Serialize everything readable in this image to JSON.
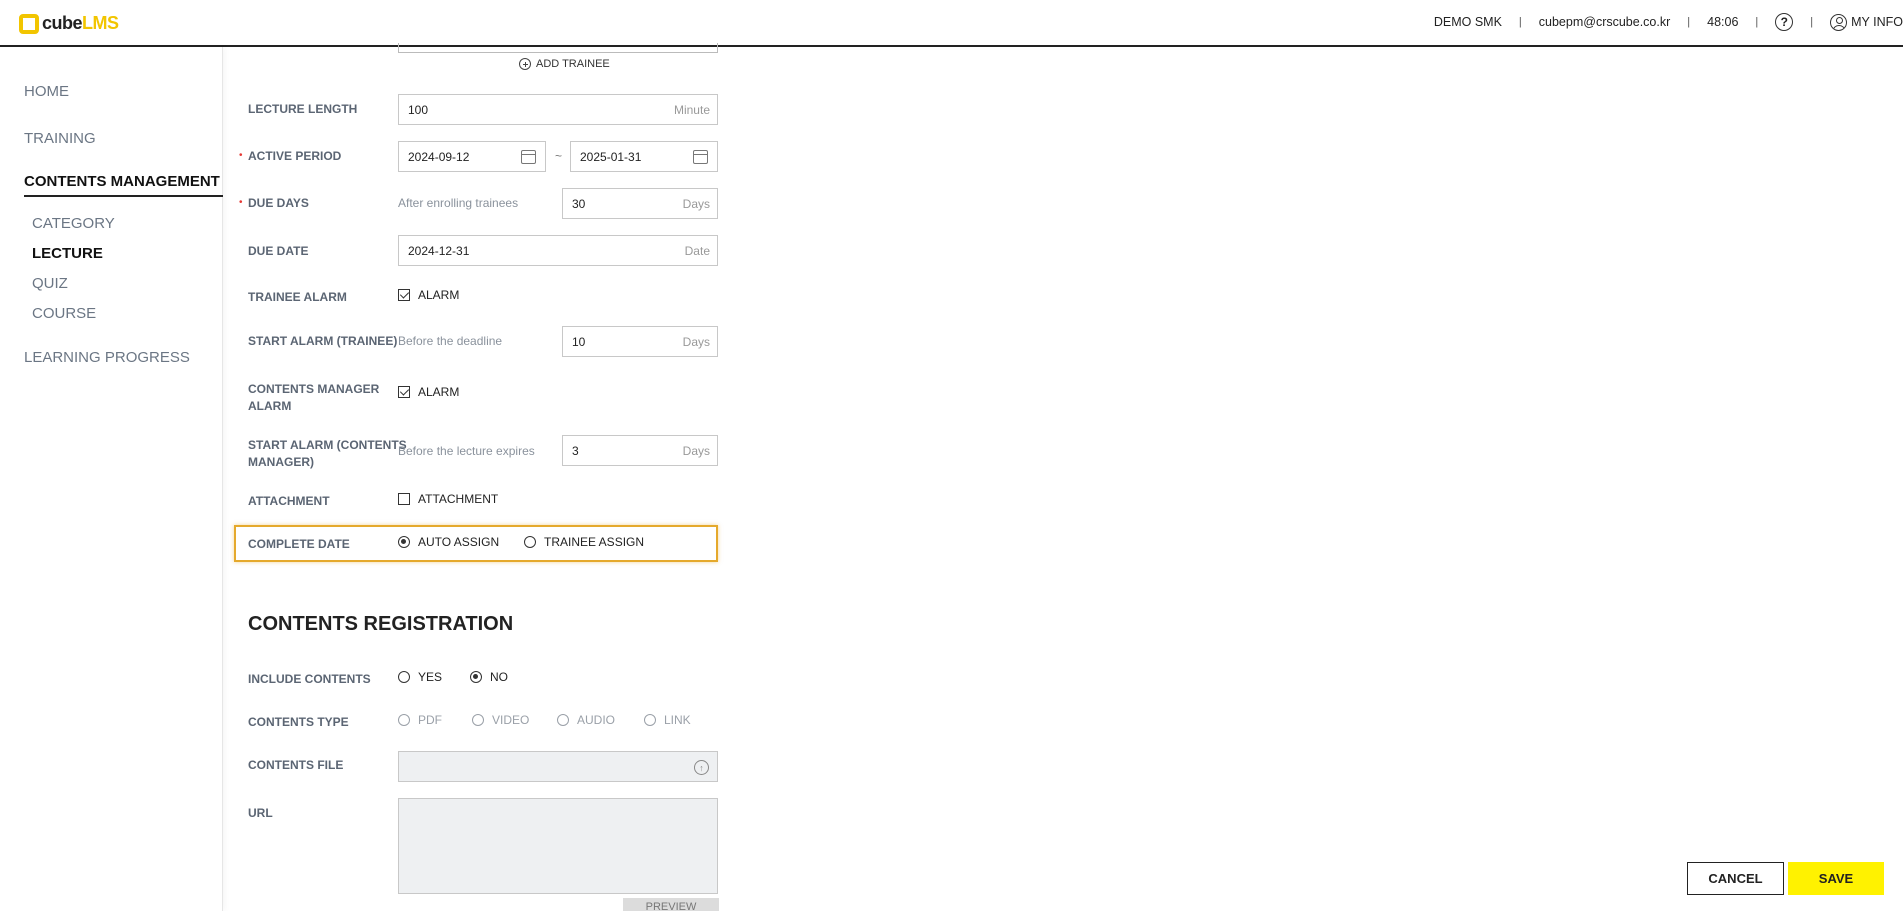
{
  "header": {
    "logo_cube": "cube",
    "logo_lms": "LMS",
    "user_name": "DEMO SMK",
    "email": "cubepm@crscube.co.kr",
    "timer": "48:06",
    "help_icon": "help-circle-icon",
    "my_info": "MY INFO",
    "separator": "|"
  },
  "sidebar": {
    "home": "HOME",
    "training": "TRAINING",
    "contents_management": "CONTENTS MANAGEMENT",
    "sub": {
      "category": "CATEGORY",
      "lecture": "LECTURE",
      "quiz": "QUIZ",
      "course": "COURSE"
    },
    "learning_progress": "LEARNING PROGRESS"
  },
  "form": {
    "add_trainee": "ADD TRAINEE",
    "lecture_length": {
      "label": "LECTURE LENGTH",
      "value": "100",
      "unit": "Minute"
    },
    "active_period": {
      "label": "ACTIVE PERIOD",
      "start": "2024-09-12",
      "end": "2025-01-31",
      "tilde": "~"
    },
    "due_days": {
      "label": "DUE DAYS",
      "hint": "After enrolling trainees",
      "value": "30",
      "unit": "Days"
    },
    "due_date": {
      "label": "DUE DATE",
      "value": "2024-12-31",
      "unit": "Date"
    },
    "trainee_alarm": {
      "label": "TRAINEE ALARM",
      "option": "ALARM",
      "checked": true
    },
    "start_alarm_trainee": {
      "label": "START ALARM (TRAINEE)",
      "hint": "Before the deadline",
      "value": "10",
      "unit": "Days"
    },
    "contents_manager_alarm": {
      "label_line1": "CONTENTS MANAGER",
      "label_line2": "ALARM",
      "option": "ALARM",
      "checked": true
    },
    "start_alarm_manager": {
      "label_line1": "START ALARM (CONTENTS",
      "label_line2": "MANAGER)",
      "hint": "Before the lecture expires",
      "value": "3",
      "unit": "Days"
    },
    "attachment": {
      "label": "ATTACHMENT",
      "option": "ATTACHMENT",
      "checked": false
    },
    "complete_date": {
      "label": "COMPLETE DATE",
      "options": [
        "AUTO ASSIGN",
        "TRAINEE ASSIGN"
      ],
      "selected": "AUTO ASSIGN"
    },
    "required_mark": "•"
  },
  "contents_registration": {
    "title": "CONTENTS REGISTRATION",
    "include_contents": {
      "label": "INCLUDE CONTENTS",
      "options": [
        "YES",
        "NO"
      ],
      "selected": "NO"
    },
    "contents_type": {
      "label": "CONTENTS TYPE",
      "options": [
        "PDF",
        "VIDEO",
        "AUDIO",
        "LINK"
      ]
    },
    "contents_file": {
      "label": "CONTENTS FILE",
      "icon": "upload-icon"
    },
    "url": {
      "label": "URL"
    },
    "preview": "PREVIEW"
  },
  "actions": {
    "cancel": "CANCEL",
    "save": "SAVE",
    "save_color": "#fff200",
    "highlight_color": "#e5a92c"
  }
}
